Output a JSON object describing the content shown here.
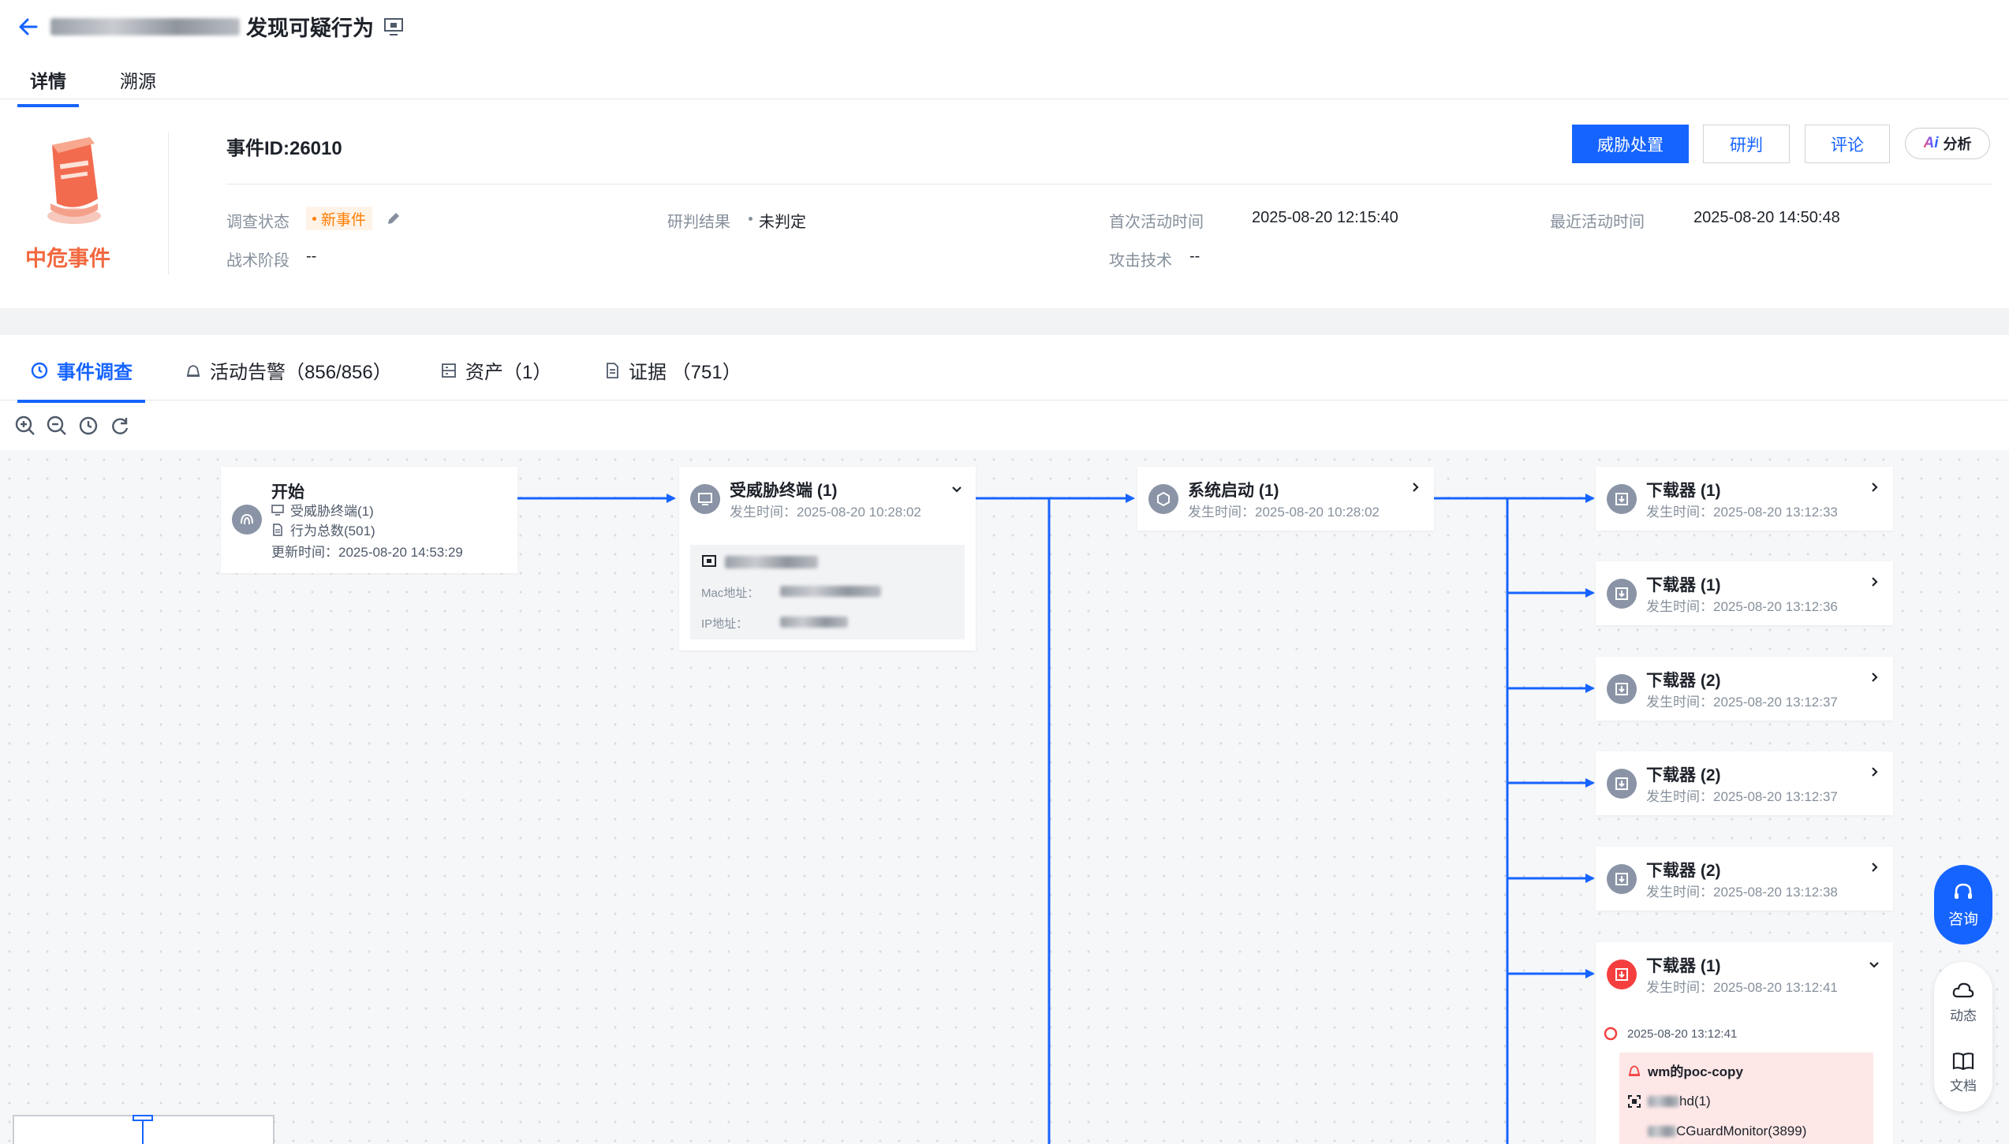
{
  "header": {
    "title_suffix": "发现可疑行为",
    "tabs": [
      "详情",
      "溯源"
    ]
  },
  "summary": {
    "severity": "中危事件",
    "event_id": "事件ID:26010",
    "actions": {
      "primary": "威胁处置",
      "judge": "研判",
      "comment": "评论",
      "ai": "分析"
    },
    "fields": {
      "status_label": "调查状态",
      "status_value": "新事件",
      "result_label": "研判结果",
      "result_value": "未判定",
      "first_label": "首次活动时间",
      "first_value": "2025-08-20 12:15:40",
      "last_label": "最近活动时间",
      "last_value": "2025-08-20 14:50:48",
      "stage_label": "战术阶段",
      "stage_value": "--",
      "tech_label": "攻击技术",
      "tech_value": "--"
    }
  },
  "inv_tabs": {
    "investigate": "事件调查",
    "alerts": "活动告警（856/856）",
    "assets": "资产（1）",
    "evidence": "证据 （751）"
  },
  "graph": {
    "start": {
      "title": "开始",
      "line1": "受威胁终端(1)",
      "line2": "行为总数(501)",
      "updated": "更新时间：2025-08-20 14:53:29"
    },
    "endpoint": {
      "title": "受威胁终端 (1)",
      "time": "发生时间：2025-08-20 10:28:02",
      "mac_label": "Mac地址：",
      "ip_label": "IP地址："
    },
    "sysboot": {
      "title": "系统启动 (1)",
      "time": "发生时间：2025-08-20 10:28:02"
    },
    "downloaders": [
      {
        "title": "下载器 (1)",
        "time": "发生时间：2025-08-20 13:12:33"
      },
      {
        "title": "下载器 (1)",
        "time": "发生时间：2025-08-20 13:12:36"
      },
      {
        "title": "下载器 (2)",
        "time": "发生时间：2025-08-20 13:12:37"
      },
      {
        "title": "下载器 (2)",
        "time": "发生时间：2025-08-20 13:12:37"
      },
      {
        "title": "下载器 (2)",
        "time": "发生时间：2025-08-20 13:12:38"
      },
      {
        "title": "下载器 (1)",
        "time": "发生时间：2025-08-20 13:12:41"
      }
    ],
    "expanded": {
      "time": "2025-08-20 13:12:41",
      "item": "wm的poc-copy",
      "sub1": "hd(1)",
      "sub2": "CGuardMonitor(3899)"
    }
  },
  "float": {
    "consult": "咨询",
    "dynamic": "动态",
    "docs": "文档"
  },
  "colors": {
    "accent": "#1664ff",
    "danger": "#f53f3f",
    "warning": "#ff7d00",
    "severity": "#f2683f"
  }
}
